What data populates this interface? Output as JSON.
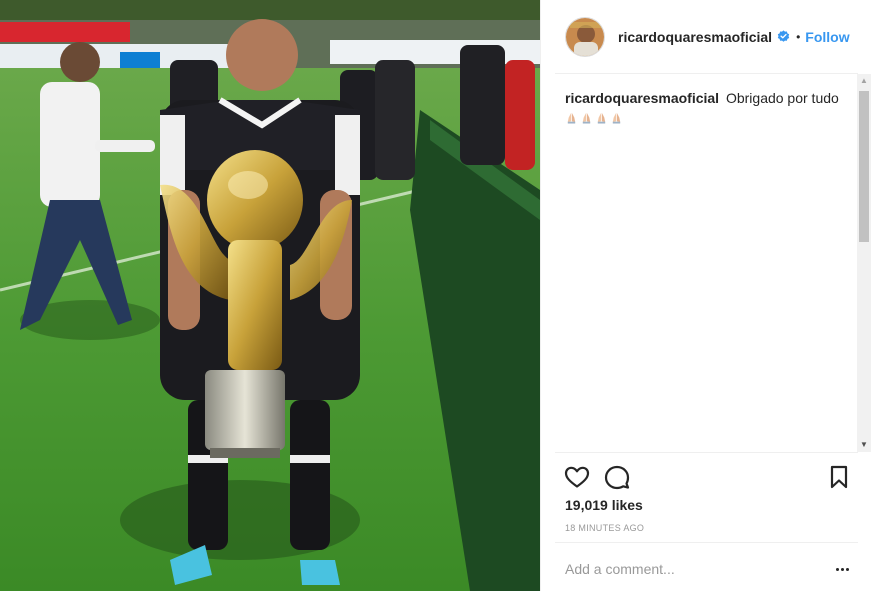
{
  "post": {
    "image": {
      "alt": ""
    },
    "header": {
      "username": "ricardoquaresmaoficial",
      "separator": "•",
      "follow_label": "Follow",
      "verified_icon": "verified-badge-icon"
    },
    "caption": {
      "username": "ricardoquaresmaoficial",
      "text": "Obrigado por tudo",
      "emoji_count": 4,
      "emoji_icon": "folded-hands-icon"
    },
    "actions": {
      "like_icon": "heart-icon",
      "comment_icon": "comment-bubble-icon",
      "save_icon": "bookmark-icon"
    },
    "likes_text": "19,019 likes",
    "timestamp": "18 MINUTES AGO",
    "comment_input": {
      "placeholder": "Add a comment...",
      "value": ""
    },
    "more_icon": "more-options-icon"
  },
  "colors": {
    "link_blue": "#3897f0",
    "text": "#262626",
    "muted": "#999999",
    "divider": "#efefef",
    "grass": "#3f8f2d"
  }
}
